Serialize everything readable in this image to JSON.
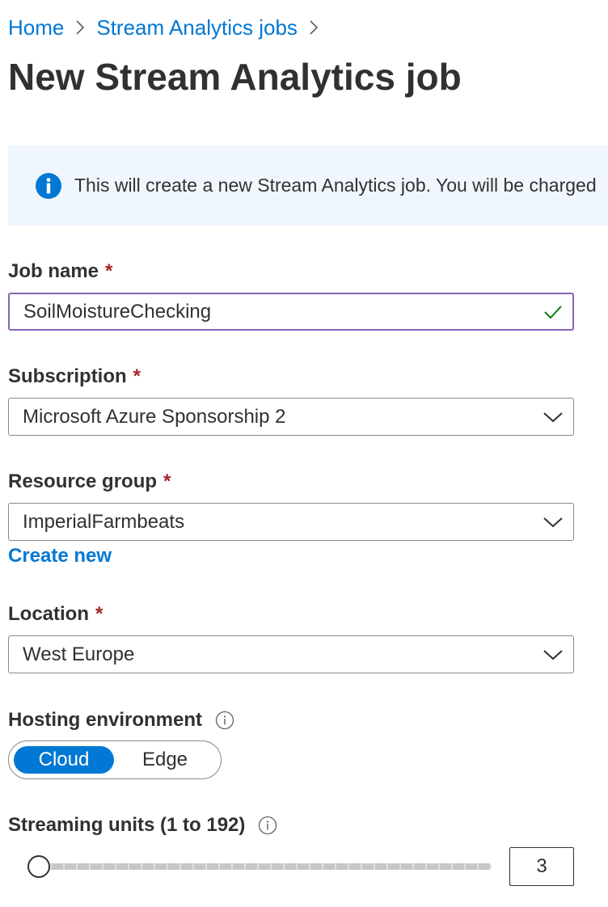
{
  "breadcrumb": {
    "items": [
      {
        "label": "Home"
      },
      {
        "label": "Stream Analytics jobs"
      }
    ]
  },
  "page_title": "New Stream Analytics job",
  "info_banner": {
    "icon": "info-icon",
    "text": "This will create a new Stream Analytics job. You will be charged"
  },
  "form": {
    "required_marker": "*",
    "job_name": {
      "label": "Job name",
      "value": "SoilMoistureChecking",
      "status_icon": "checkmark-icon"
    },
    "subscription": {
      "label": "Subscription",
      "selected": "Microsoft Azure Sponsorship 2"
    },
    "resource_group": {
      "label": "Resource group",
      "selected": "ImperialFarmbeats",
      "create_new_label": "Create new"
    },
    "location": {
      "label": "Location",
      "selected": "West Europe"
    },
    "hosting_environment": {
      "label": "Hosting environment",
      "options": [
        "Cloud",
        "Edge"
      ],
      "selected": "Cloud"
    },
    "streaming_units": {
      "label": "Streaming units (1 to 192)",
      "value": "3",
      "min": 1,
      "max": 192
    }
  },
  "colors": {
    "link": "#0078d4",
    "required": "#a4262c",
    "focus_border": "#8764b8",
    "success": "#107c10",
    "banner_background": "#f0f6fd",
    "toggle_selected": "#0078d4"
  }
}
